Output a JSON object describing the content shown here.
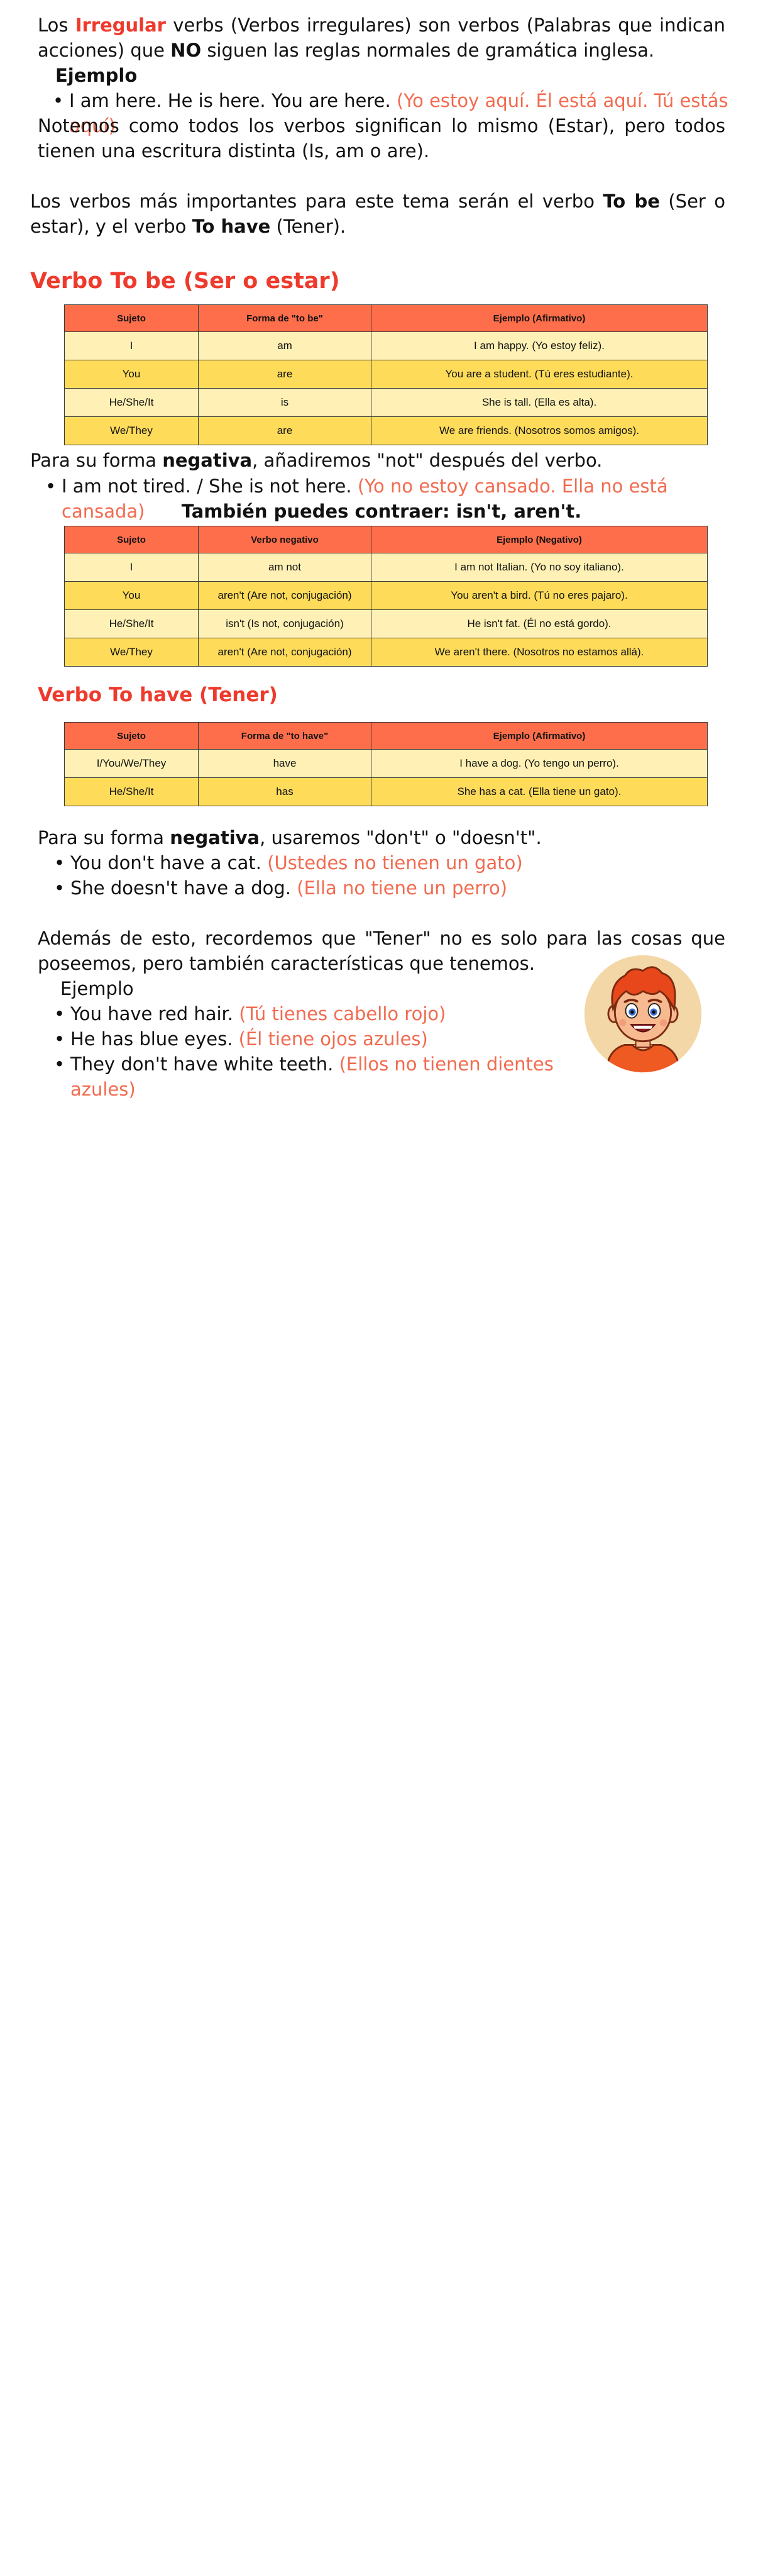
{
  "intro": {
    "p1_a": "Los",
    "p1_red": "Irregular",
    "p1_b": "verbs (Verbos irregulares) son verbos (Palabras que indican acciones) que",
    "p1_bold": "NO",
    "p1_c": "siguen las reglas normales de gramática inglesa.",
    "example_heading": "Ejemplo",
    "example_en": "I am here. He is here. You are here.",
    "example_es": "(Yo estoy aquí. Él está aquí. Tú estás aquí)",
    "p2": "Notemos como todos los verbos significan lo mismo (Estar), pero todos tienen una escritura distinta (Is, am o are).",
    "p3_a": "Los verbos más importantes para este tema serán el verbo",
    "p3_b1": "To be",
    "p3_c": "(Ser o estar), y el verbo",
    "p3_b2": "To have",
    "p3_d": "(Tener)."
  },
  "tobe": {
    "heading": "Verbo To be (Ser o estar)",
    "table1": {
      "headers": [
        "Sujeto",
        "Forma de \"to be\"",
        "Ejemplo (Afirmativo)"
      ],
      "rows": [
        [
          "I",
          "am",
          "I am happy. (Yo estoy feliz)."
        ],
        [
          "You",
          "are",
          "You are a student. (Tú eres estudiante)."
        ],
        [
          "He/She/It",
          "is",
          "She is tall. (Ella es alta)."
        ],
        [
          "We/They",
          "are",
          "We are friends. (Nosotros somos amigos)."
        ]
      ]
    },
    "neg_a": "Para su forma",
    "neg_bold": "negativa",
    "neg_b": ", añadiremos \"not\" después del verbo.",
    "neg_example_en": "I am not tired. / She is not here.",
    "neg_example_es": "(Yo no estoy cansado. Ella no está cansada)",
    "contract": "También puedes contraer: isn't, aren't.",
    "table2": {
      "headers": [
        "Sujeto",
        "Verbo negativo",
        "Ejemplo (Negativo)"
      ],
      "rows": [
        [
          "I",
          "am not",
          "I am not Italian. (Yo no soy italiano)."
        ],
        [
          "You",
          "aren't (Are not, conjugación)",
          "You aren't a bird. (Tú no eres pajaro)."
        ],
        [
          "He/She/It",
          "isn't (Is not, conjugación)",
          "He isn't fat. (Él no está gordo)."
        ],
        [
          "We/They",
          "aren't (Are not, conjugación)",
          "We aren't there. (Nosotros no estamos allá)."
        ]
      ]
    }
  },
  "tohave": {
    "heading": "Verbo To have (Tener)",
    "table": {
      "headers": [
        "Sujeto",
        "Forma de \"to have\"",
        "Ejemplo (Afirmativo)"
      ],
      "rows": [
        [
          "I/You/We/They",
          "have",
          "I have a dog. (Yo tengo un perro)."
        ],
        [
          "He/She/It",
          "has",
          "She has a cat. (Ella tiene un gato)."
        ]
      ]
    },
    "neg_a": "Para su forma",
    "neg_bold": "negativa",
    "neg_b": ", usaremos \"don't\" o \"doesn't\".",
    "neg_items": [
      {
        "en": "You don't have a cat.",
        "es": "(Ustedes no tienen un gato)"
      },
      {
        "en": "She doesn't have a dog.",
        "es": "(Ella no tiene un perro)"
      }
    ],
    "extra": "Además de esto, recordemos que \"Tener\" no es solo para las cosas que poseemos, pero también características que tenemos.",
    "example_heading": "Ejemplo",
    "examples": [
      {
        "en": "You have red hair.",
        "es": "(Tú tienes cabello rojo)"
      },
      {
        "en": "He has blue eyes.",
        "es": "(Él tiene ojos azules)"
      },
      {
        "en": "They don't have white teeth.",
        "es": "(Ellos no tienen dientes azules)"
      }
    ]
  },
  "colors": {
    "accent_red": "#ee3a2c",
    "header_orange": "#ff6e4a",
    "row_light": "#fff1b5",
    "row_dark": "#fedc5a"
  },
  "illustration": "boy-avatar-icon"
}
